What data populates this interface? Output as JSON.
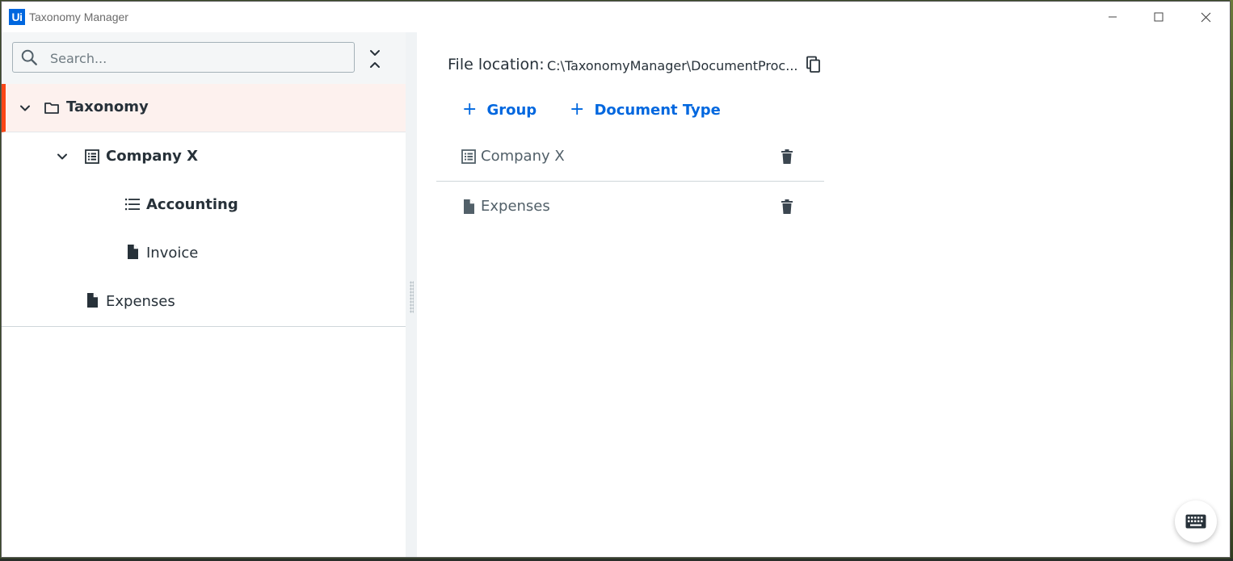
{
  "window": {
    "logo_text": "Ui",
    "title": "Taxonomy Manager"
  },
  "search": {
    "placeholder": "Search..."
  },
  "tree": {
    "root": {
      "label": "Taxonomy",
      "icon": "folder-icon",
      "expanded": true,
      "selected": true
    },
    "group": {
      "label": "Company X",
      "icon": "group-icon",
      "expanded": true
    },
    "category": {
      "label": "Accounting",
      "icon": "list-icon"
    },
    "doc_invoice": {
      "label": "Invoice",
      "icon": "document-icon"
    },
    "doc_expenses": {
      "label": "Expenses",
      "icon": "document-icon"
    }
  },
  "details": {
    "file_location_label": "File location:",
    "file_location_path": "C:\\TaxonomyManager\\DocumentProc...",
    "add_group_label": "Group",
    "add_document_type_label": "Document Type",
    "items": [
      {
        "label": "Company X",
        "icon": "group-icon"
      },
      {
        "label": "Expenses",
        "icon": "document-icon"
      }
    ]
  },
  "colors": {
    "accent": "#fa4616",
    "primary_link": "#0067df",
    "selected_bg": "#fdf1ee"
  }
}
